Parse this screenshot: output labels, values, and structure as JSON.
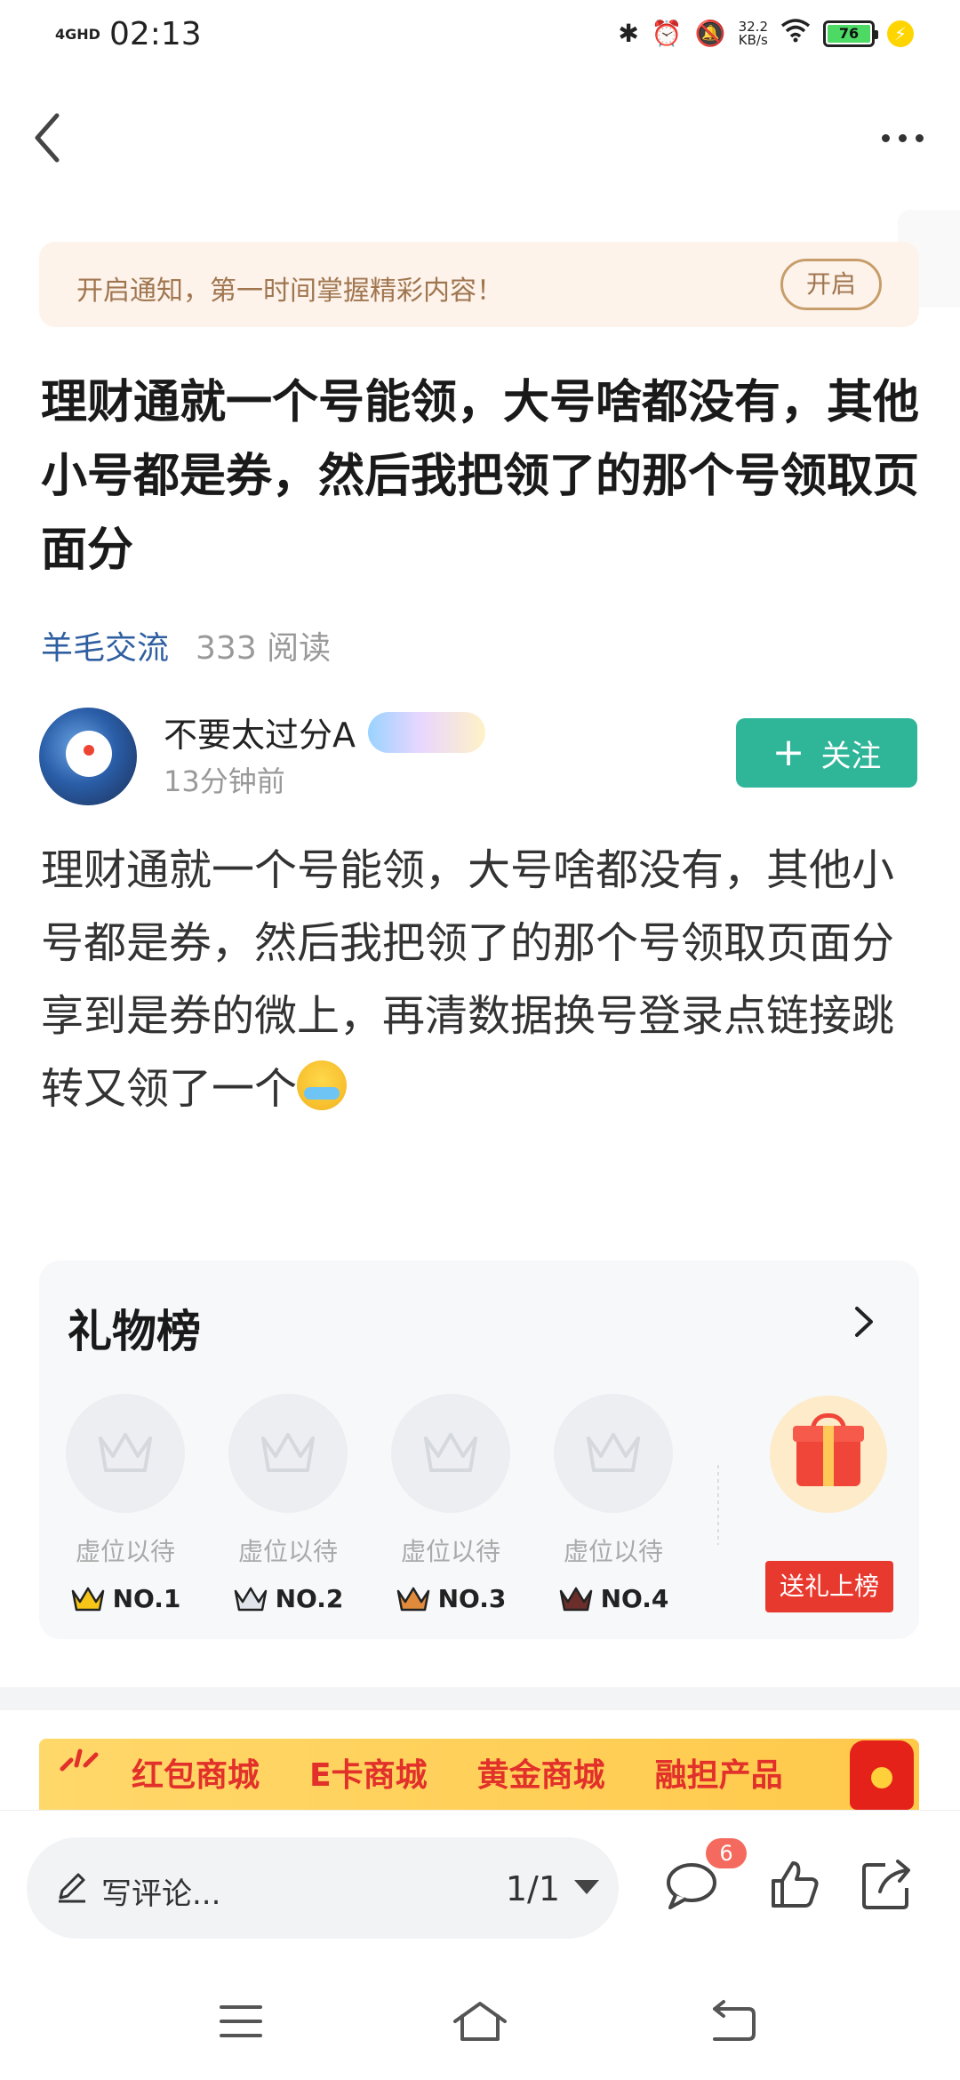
{
  "status_bar": {
    "network": "4GHD",
    "time": "02:13",
    "speed_value": "32.2",
    "speed_unit": "KB/s",
    "battery": "76",
    "icons": [
      "bluetooth-icon",
      "alarm-icon",
      "mute-icon",
      "wifi-icon",
      "battery-icon",
      "charging-icon"
    ]
  },
  "nav": {
    "back_icon": "chevron-left-icon",
    "more_icon": "more-dots-icon"
  },
  "notice": {
    "text": "开启通知，第一时间掌握精彩内容！",
    "button": "开启"
  },
  "post": {
    "title": "理财通就一个号能领，大号啥都没有，其他小号都是券，然后我把领了的那个号领取页面分",
    "tag": "羊毛交流",
    "reads": "333 阅读",
    "author": {
      "name": "不要太过分A",
      "medal": "梦幻勋章",
      "time": "13分钟前"
    },
    "follow": "关注",
    "body": "理财通就一个号能领，大号啥都没有，其他小号都是券，然后我把领了的那个号领取页面分享到是券的微上，再清数据换号登录点链接跳转又领了一个"
  },
  "gift_board": {
    "title": "礼物榜",
    "slots": [
      {
        "label": "虚位以待",
        "rank": "NO.1"
      },
      {
        "label": "虚位以待",
        "rank": "NO.2"
      },
      {
        "label": "虚位以待",
        "rank": "NO.3"
      },
      {
        "label": "虚位以待",
        "rank": "NO.4"
      }
    ],
    "send_button": "送礼上榜"
  },
  "banner": {
    "items": [
      "红包商城",
      "E卡商城",
      "黄金商城",
      "融担产品"
    ]
  },
  "bottom_bar": {
    "comment_placeholder": "写评论...",
    "page": "1/1",
    "comment_count": "6"
  },
  "colors": {
    "accent_green": "#2fb598",
    "send_red": "#e8392f",
    "tag_blue": "#2f5fa0",
    "notice_bg": "#fdf3ea"
  }
}
